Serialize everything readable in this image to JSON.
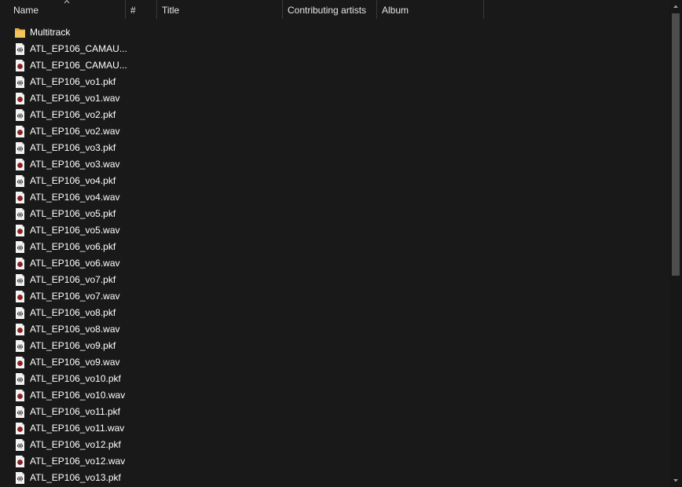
{
  "columns": {
    "name": "Name",
    "number": "#",
    "title": "Title",
    "contributing_artists": "Contributing artists",
    "album": "Album"
  },
  "sort": {
    "column": "Name",
    "direction": "ascending"
  },
  "files": [
    {
      "name": "Multitrack",
      "type": "folder"
    },
    {
      "name": "ATL_EP106_CAMAU...",
      "type": "pkf"
    },
    {
      "name": "ATL_EP106_CAMAU...",
      "type": "wav"
    },
    {
      "name": "ATL_EP106_vo1.pkf",
      "type": "pkf"
    },
    {
      "name": "ATL_EP106_vo1.wav",
      "type": "wav"
    },
    {
      "name": "ATL_EP106_vo2.pkf",
      "type": "pkf"
    },
    {
      "name": "ATL_EP106_vo2.wav",
      "type": "wav"
    },
    {
      "name": "ATL_EP106_vo3.pkf",
      "type": "pkf"
    },
    {
      "name": "ATL_EP106_vo3.wav",
      "type": "wav"
    },
    {
      "name": "ATL_EP106_vo4.pkf",
      "type": "pkf"
    },
    {
      "name": "ATL_EP106_vo4.wav",
      "type": "wav"
    },
    {
      "name": "ATL_EP106_vo5.pkf",
      "type": "pkf"
    },
    {
      "name": "ATL_EP106_vo5.wav",
      "type": "wav"
    },
    {
      "name": "ATL_EP106_vo6.pkf",
      "type": "pkf"
    },
    {
      "name": "ATL_EP106_vo6.wav",
      "type": "wav"
    },
    {
      "name": "ATL_EP106_vo7.pkf",
      "type": "pkf"
    },
    {
      "name": "ATL_EP106_vo7.wav",
      "type": "wav"
    },
    {
      "name": "ATL_EP106_vo8.pkf",
      "type": "pkf"
    },
    {
      "name": "ATL_EP106_vo8.wav",
      "type": "wav"
    },
    {
      "name": "ATL_EP106_vo9.pkf",
      "type": "pkf"
    },
    {
      "name": "ATL_EP106_vo9.wav",
      "type": "wav"
    },
    {
      "name": "ATL_EP106_vo10.pkf",
      "type": "pkf"
    },
    {
      "name": "ATL_EP106_vo10.wav",
      "type": "wav"
    },
    {
      "name": "ATL_EP106_vo11.pkf",
      "type": "pkf"
    },
    {
      "name": "ATL_EP106_vo11.wav",
      "type": "wav"
    },
    {
      "name": "ATL_EP106_vo12.pkf",
      "type": "pkf"
    },
    {
      "name": "ATL_EP106_vo12.wav",
      "type": "wav"
    },
    {
      "name": "ATL_EP106_vo13.pkf",
      "type": "pkf"
    }
  ],
  "icons": {
    "folder": "folder-icon",
    "pkf": "waveform-file-icon",
    "wav": "audio-file-icon",
    "sort": "sort-up-caret-icon",
    "scroll_up": "scroll-up-arrow-icon",
    "scroll_down": "scroll-down-arrow-icon"
  },
  "colors": {
    "background": "#191919",
    "text": "#ffffff",
    "header_text": "#e6e6e6",
    "separator": "#3a3a3a",
    "folder": "#f2c55c",
    "audio_accent": "#b32626",
    "scroll_thumb": "#4d4d4d"
  }
}
